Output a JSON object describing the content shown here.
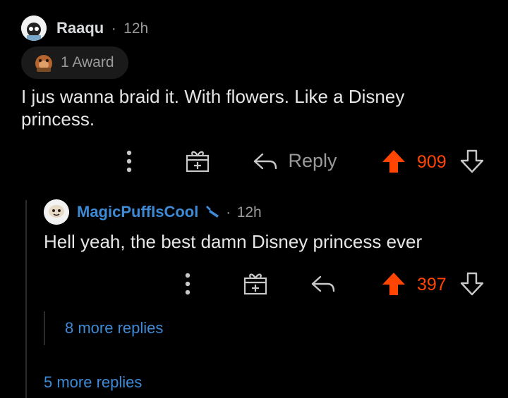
{
  "comment1": {
    "username": "Raaqu",
    "separator": "·",
    "time": "12h",
    "award_label": "1 Award",
    "body": "I jus wanna braid it. With flowers. Like a Disney princess.",
    "reply_label": "Reply",
    "score": "909"
  },
  "comment2": {
    "username": "MagicPuffIsCool",
    "separator": "·",
    "time": "12h",
    "body": "Hell yeah, the best damn Disney princess ever",
    "score": "397"
  },
  "more_replies_nested": "8 more replies",
  "more_replies": "5 more replies",
  "icons": {
    "more": "vertical-dots-icon",
    "gift": "gift-icon",
    "reply": "reply-arrow-icon",
    "upvote": "upvote-arrow-icon",
    "downvote": "downvote-arrow-icon",
    "mod": "wrench-icon"
  },
  "colors": {
    "upvoted": "#ff4500",
    "link": "#3d8ad6",
    "username2": "#3d8ad6",
    "text": "#d7dadc",
    "muted": "#9a9a9a"
  }
}
